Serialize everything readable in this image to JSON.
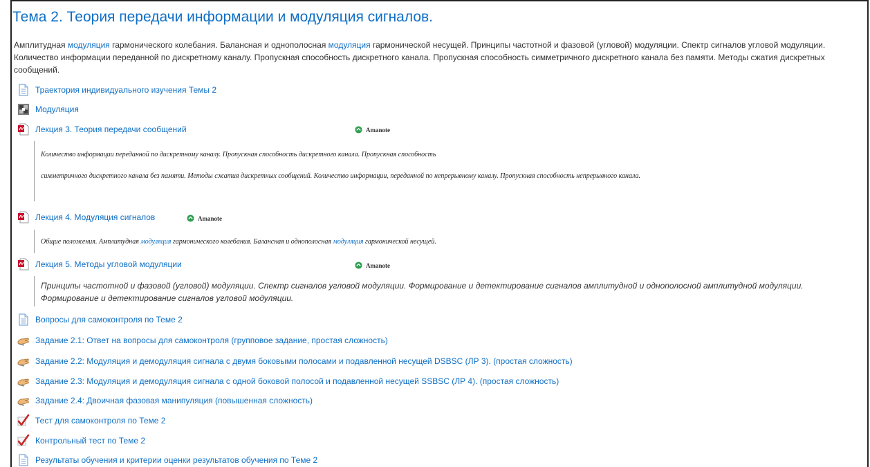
{
  "topic": {
    "title": "Тема 2. Теория передачи информации и модуляция сигналов.",
    "summary": {
      "p1": "Амплитудная ",
      "kw1": "модуляция",
      "p2": " гармонического колебания. Балансная и однополосная ",
      "kw2": "модуляция",
      "p3": " гармонической несущей. Принципы частотной и фазовой (угловой) модуляции. Спектр сигналов угловой модуляции. Количество информации переданной по дискретному каналу. Пропускная способность дискретного канала. Пропускная способность симметричного дискретного канала без памяти. Методы сжатия дискретных сообщений."
    }
  },
  "amanote_label": "Amanote",
  "activities": {
    "trajectory": "Траектория индивидуального изучения Темы 2",
    "modulation": "Модуляция",
    "lecture3": "Лекция 3. Теория передачи сообщений",
    "lecture4": "Лекция 4. Модуляция сигналов",
    "lecture5": "Лекция 5. Методы угловой модуляции",
    "questions": "Вопросы для самоконтроля по Теме 2",
    "task21": "Задание 2.1: Ответ на вопросы для самоконтроля (групповое задание, простая сложность)",
    "task22": "Задание 2.2: Модуляция и демодуляция сигнала с двумя боковыми полосами и подавленной несущей DSBSC (ЛР 3). (простая сложность)",
    "task23": "Задание 2.3: Модуляция и демодуляция сигнала с одной боковой полосой и подавленной несущей SSBSC (ЛР 4). (простая сложность)",
    "task24": "Задание 2.4: Двоичная фазовая манипуляция (повышенная сложность)",
    "selftest": "Тест для самоконтроля по Теме 2",
    "control": "Контрольный тест по Теме 2",
    "results": "Результаты обучения и критерии оценки результатов обучения по Теме 2"
  },
  "descriptions": {
    "lecture3_line1": "Количество информации переданной по дискретному каналу. Пропускная способность дискретного канала. Пропускная способность",
    "lecture3_line2": "симметричного дискретного канала без памяти.  Методы сжатия дискретных сообщений. Количество информации, переданной по непрерывному каналу. Пропускная способность непрерывного канала.",
    "lecture4_p1": "Общие положения. Амплитудная ",
    "lecture4_kw1": "модуляция",
    "lecture4_p2": " гармонического колебания. Балансная и однополосная ",
    "lecture4_kw2": "модуляция",
    "lecture4_p3": " гармонической несущей.",
    "lecture5": "Принципы частотной и фазовой (угловой) модуляции. Спектр сигналов угловой модуляции. Формирование и детектирование сигналов амплитудной и однополосной амплитудной модуляции. Формирование и детектирование сигналов угловой модуляции."
  },
  "colors": {
    "link": "#0f6fc5",
    "pdf": "#c8102e",
    "amanote": "#2e9e4f"
  }
}
